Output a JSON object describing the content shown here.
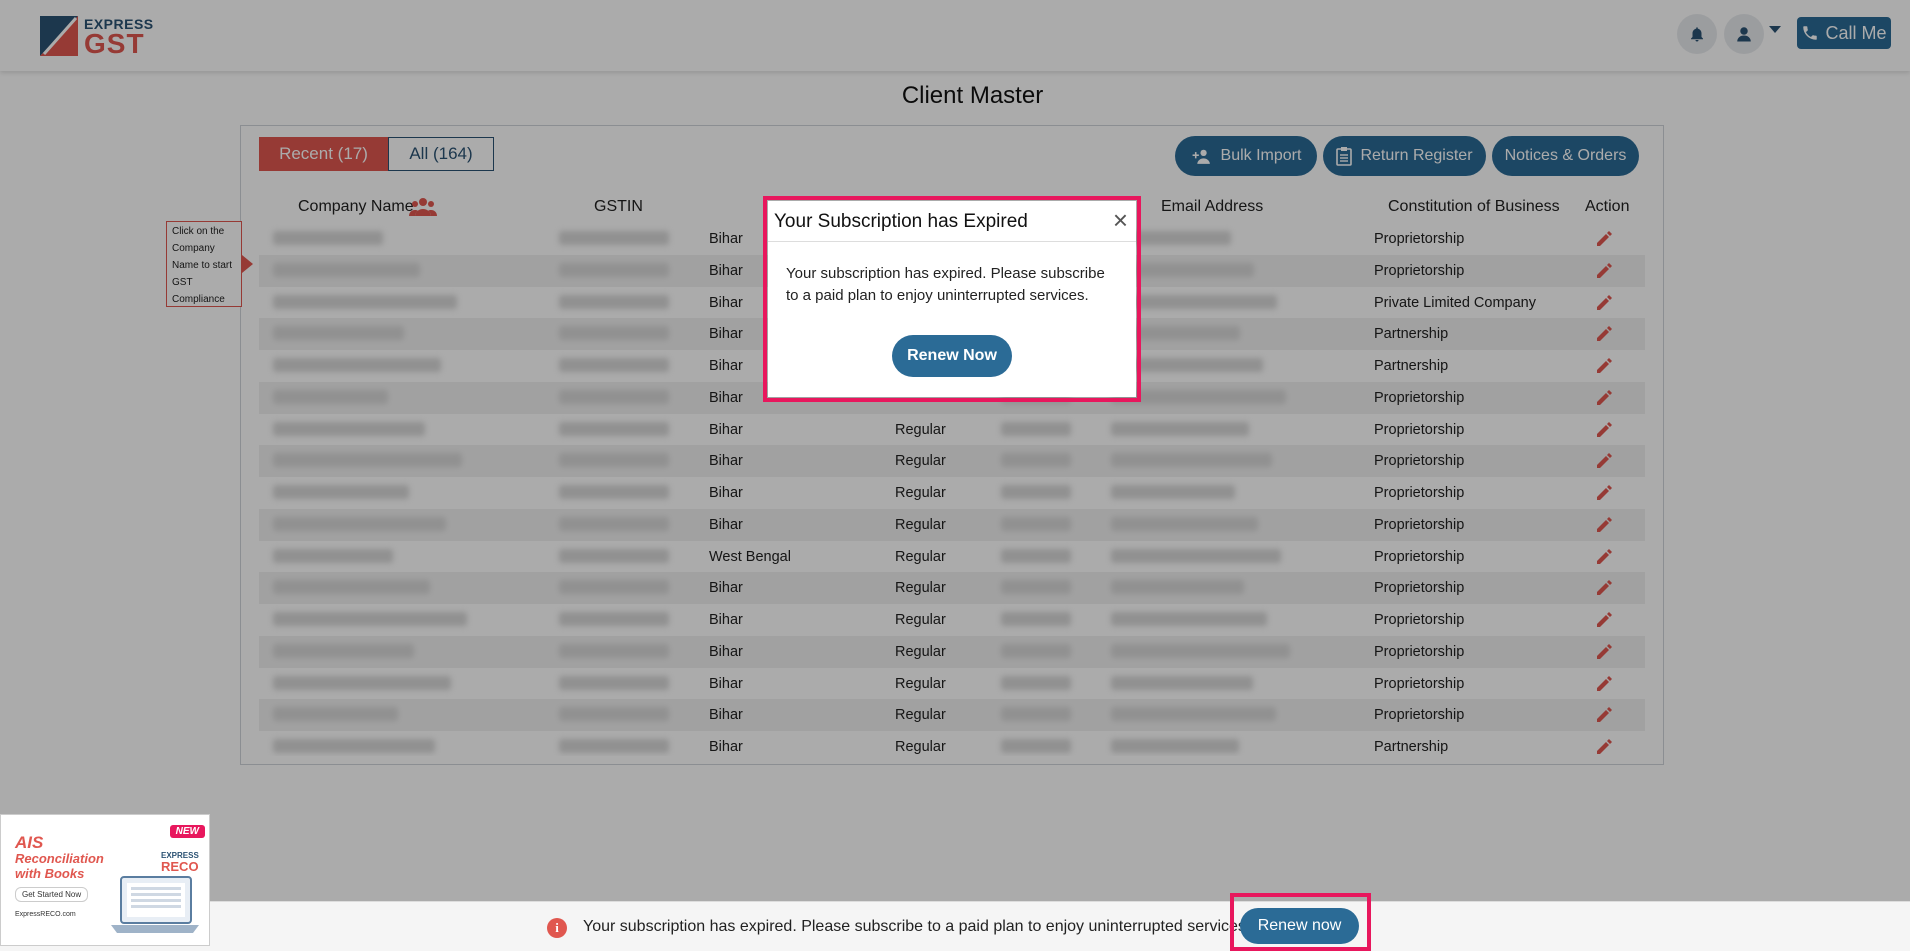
{
  "brand": {
    "logo_small": "EXPRESS",
    "logo_big": "GST"
  },
  "header": {
    "call_label": "Call Me"
  },
  "page": {
    "title": "Client Master"
  },
  "tabs": {
    "recent": "Recent (17)",
    "all": "All (164)"
  },
  "actions": {
    "bulk_import": "Bulk Import",
    "return_register": "Return Register",
    "notices_orders": "Notices & Orders"
  },
  "table": {
    "headers": {
      "company": "Company Name",
      "gstin": "GSTIN",
      "email": "Email Address",
      "constitution": "Constitution of Business",
      "action": "Action"
    },
    "rows": [
      {
        "state": "Bihar",
        "type": "",
        "constitution": "Proprietorship"
      },
      {
        "state": "Bihar",
        "type": "",
        "constitution": "Proprietorship"
      },
      {
        "state": "Bihar",
        "type": "",
        "constitution": "Private Limited Company"
      },
      {
        "state": "Bihar",
        "type": "",
        "constitution": "Partnership"
      },
      {
        "state": "Bihar",
        "type": "",
        "constitution": "Partnership"
      },
      {
        "state": "Bihar",
        "type": "",
        "constitution": "Proprietorship"
      },
      {
        "state": "Bihar",
        "type": "Regular",
        "constitution": "Proprietorship"
      },
      {
        "state": "Bihar",
        "type": "Regular",
        "constitution": "Proprietorship"
      },
      {
        "state": "Bihar",
        "type": "Regular",
        "constitution": "Proprietorship"
      },
      {
        "state": "Bihar",
        "type": "Regular",
        "constitution": "Proprietorship"
      },
      {
        "state": "West Bengal",
        "type": "Regular",
        "constitution": "Proprietorship"
      },
      {
        "state": "Bihar",
        "type": "Regular",
        "constitution": "Proprietorship"
      },
      {
        "state": "Bihar",
        "type": "Regular",
        "constitution": "Proprietorship"
      },
      {
        "state": "Bihar",
        "type": "Regular",
        "constitution": "Proprietorship"
      },
      {
        "state": "Bihar",
        "type": "Regular",
        "constitution": "Proprietorship"
      },
      {
        "state": "Bihar",
        "type": "Regular",
        "constitution": "Proprietorship"
      },
      {
        "state": "Bihar",
        "type": "Regular",
        "constitution": "Partnership"
      }
    ]
  },
  "hint": {
    "text": "Click on the Company Name to start GST Compliance"
  },
  "modal": {
    "title": "Your Subscription has Expired",
    "close": "×",
    "body": "Your subscription has expired. Please subscribe to a paid plan to enjoy uninterrupted services.",
    "button": "Renew Now"
  },
  "bottom_bar": {
    "info_icon": "i",
    "message": "Your subscription has expired. Please subscribe to a paid plan to enjoy uninterrupted services.",
    "button": "Renew now"
  },
  "ad": {
    "badge": "NEW",
    "title": "AIS",
    "subtitle": "Reconciliation with Books",
    "cta": "Get Started Now",
    "url": "ExpressRECO.com",
    "brand_small": "EXPRESS",
    "brand_big": "RECO"
  },
  "colors": {
    "brand_blue": "#2b6b96",
    "brand_red": "#e0574f",
    "highlight": "#e8175d"
  }
}
